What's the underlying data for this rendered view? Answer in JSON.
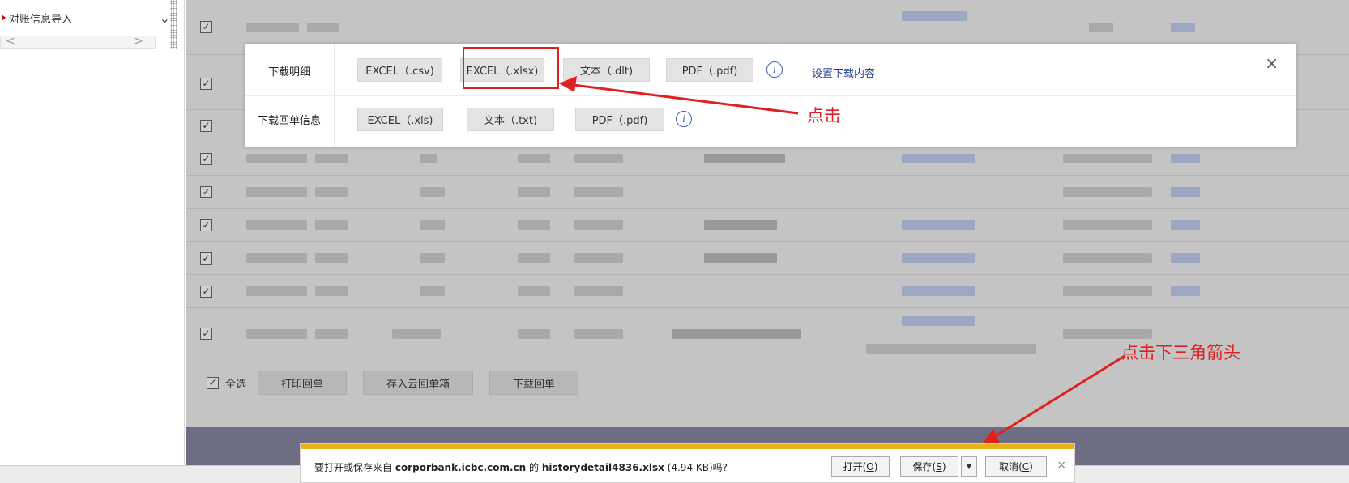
{
  "sidebar": {
    "item_label": "对账信息导入",
    "scroll_left": "<",
    "scroll_right": ">",
    "chevron": "⌄"
  },
  "popup": {
    "row1_label": "下载明细",
    "row1_buttons": [
      "EXCEL（.csv)",
      "EXCEL（.xlsx)",
      "文本（.dlt)",
      "PDF（.pdf)"
    ],
    "settings_link": "设置下载内容",
    "row2_label": "下载回单信息",
    "row2_buttons": [
      "EXCEL（.xls)",
      "文本（.txt)",
      "PDF（.pdf)"
    ],
    "info_glyph": "i",
    "close": "×"
  },
  "bottom_bar": {
    "select_all": "全选",
    "print_receipt": "打印回单",
    "save_to_cloud": "存入云回单箱",
    "download_receipt": "下载回单"
  },
  "annotations": {
    "click_xlsx": "点击",
    "click_arrow": "点击下三角箭头"
  },
  "download_notice": {
    "prefix": "要打开或保存来自 ",
    "domain": "corporbank.icbc.com.cn",
    "middle": " 的 ",
    "filename": "historydetail4836.xlsx",
    "size": " (4.94 KB)吗?",
    "open_label": "打开(",
    "open_key": "O",
    "save_label": "保存(",
    "save_key": "S",
    "cancel_label": "取消(",
    "cancel_key": "C",
    "close_paren": ")",
    "dropdown_glyph": "▼",
    "close": "×"
  },
  "colors": {
    "annotation_red": "#e02020",
    "notice_band": "#e8b119",
    "link_blue": "#1f3f8f",
    "overlay_gray": "#c4c4c4",
    "footer_band": "#6d6e83"
  },
  "icons": [
    "info-icon",
    "close-icon",
    "dropdown-triangle-icon",
    "checkbox-icon",
    "chevron-down-icon"
  ]
}
